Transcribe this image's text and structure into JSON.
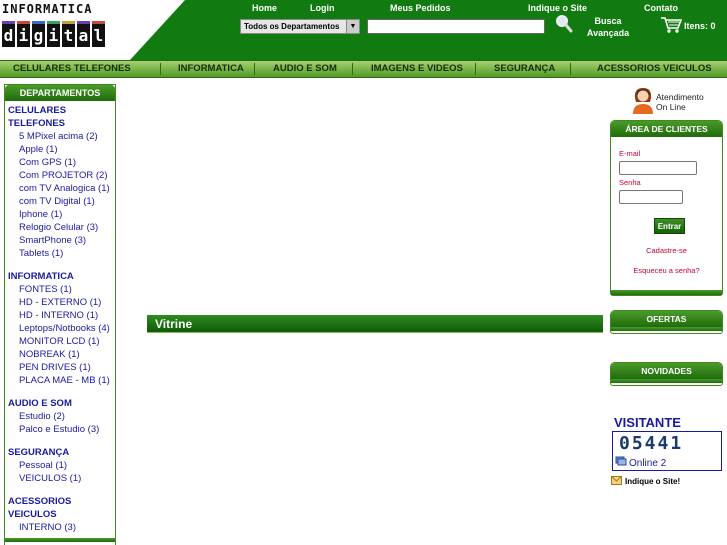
{
  "logo": {
    "word": "INFORMATICA",
    "tiles": [
      "d",
      "i",
      "g",
      "i",
      "t",
      "a",
      "l"
    ]
  },
  "topnav": {
    "home": "Home",
    "login": "Login",
    "pedidos": "Meus Pedidos",
    "indique": "Indique o Site",
    "contato": "Contato"
  },
  "search": {
    "department": "Todos os Departamentos",
    "busca_line1": "Busca",
    "busca_line2": "Avançada"
  },
  "cart": {
    "label": "Itens: 0"
  },
  "menu": [
    "CELULARES TELEFONES",
    "INFORMATICA",
    "AUDIO E SOM",
    "IMAGENS E VIDEOS",
    "SEGURANÇA",
    "ACESSORIOS VEICULOS"
  ],
  "sidebar": {
    "title": "DEPARTAMENTOS",
    "categories": [
      {
        "title_lines": [
          "CELULARES",
          "TELEFONES"
        ],
        "items": [
          "5 MPixel acima (2)",
          "Apple (1)",
          "Com GPS (1)",
          "Com PROJETOR (2)",
          "com TV Analogica (1)",
          "com TV Digital (1)",
          "Iphone (1)",
          "Relogio Celular  (3)",
          "SmartPhone (3)",
          "Tablets (1)"
        ]
      },
      {
        "title_lines": [
          "INFORMATICA"
        ],
        "items": [
          "FONTES (1)",
          "HD - EXTERNO (1)",
          "HD - INTERNO (1)",
          "Leptops/Notbooks (4)",
          "MONITOR LCD (1)",
          "NOBREAK (1)",
          "PEN DRIVES (1)",
          "PLACA MAE - MB (1)"
        ]
      },
      {
        "title_lines": [
          "AUDIO E SOM"
        ],
        "items": [
          "Estudio (2)",
          "Palco e Estudio (3)"
        ]
      },
      {
        "title_lines": [
          "SEGURANÇA"
        ],
        "items": [
          "Pessoal (1)",
          "VEICULOS (1)"
        ]
      },
      {
        "title_lines": [
          "ACESSORIOS",
          "VEICULOS"
        ],
        "items": [
          "INTERNO (3)"
        ]
      }
    ]
  },
  "main": {
    "vitrine": "Vitrine"
  },
  "right": {
    "atendimento_line1": "Atendimento",
    "atendimento_line2": "On Line",
    "area_title": "ÁREA DE CLIENTES",
    "email_label": "E-mail",
    "senha_label": "Senha",
    "entrar": "Entrar",
    "cadastre": "Cadastre-se",
    "esqueceu": "Esqueceu a senha?",
    "ofertas": "OFERTAS",
    "novidades": "NOVIDADES",
    "visitante": "VISITANTE",
    "counter": "05441",
    "online": "Online 2",
    "indique": "Indique o Site!"
  },
  "colors": {
    "brand_green": "#117a11",
    "link_blue": "#1a1aa0",
    "accent_red": "#cc0033"
  }
}
